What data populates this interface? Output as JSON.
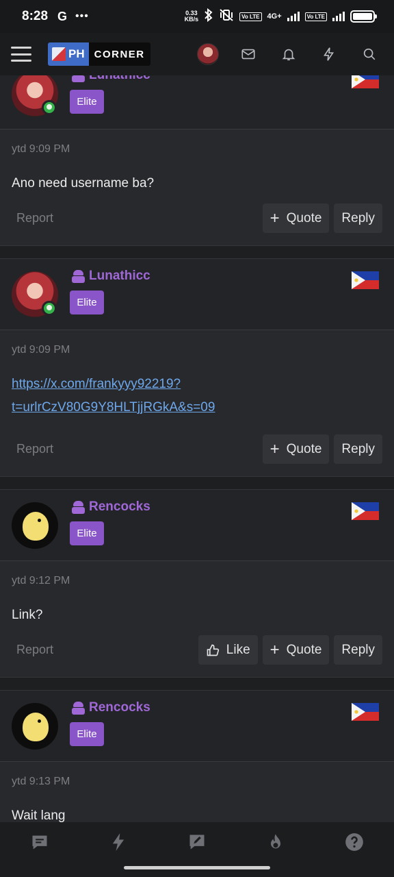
{
  "status_bar": {
    "time": "8:28",
    "carrier_glyph": "G",
    "more": "•••",
    "speed_top": "0.33",
    "speed_bottom": "KB/s",
    "volte_1": "Vo LTE",
    "network": "4G+",
    "volte_2": "Vo LTE"
  },
  "header": {
    "logo_ph": "PH",
    "logo_corner": "CORNER",
    "icons": [
      "menu-icon",
      "avatar",
      "mail-icon",
      "bell-icon",
      "bolt-icon",
      "search-icon"
    ]
  },
  "posts": [
    {
      "username": "Lunathicc",
      "badge": "Elite",
      "avatar": "anime-girl",
      "online": true,
      "timestamp": "ytd 9:09 PM",
      "message": "Ano need username ba?",
      "link": "",
      "report": "Report",
      "buttons": {
        "like": "",
        "quote": "Quote",
        "reply": "Reply"
      }
    },
    {
      "username": "Lunathicc",
      "badge": "Elite",
      "avatar": "anime-girl",
      "online": true,
      "timestamp": "ytd 9:09 PM",
      "message": "",
      "link_line1": "https://x.com/frankyyy92219?",
      "link_line2": "t=urlrCzV80G9Y8HLTjjRGkA&s=09",
      "report": "Report",
      "buttons": {
        "like": "",
        "quote": "Quote",
        "reply": "Reply"
      }
    },
    {
      "username": "Rencocks",
      "badge": "Elite",
      "avatar": "chick",
      "online": false,
      "timestamp": "ytd 9:12 PM",
      "message": "Link?",
      "report": "Report",
      "buttons": {
        "like": "Like",
        "quote": "Quote",
        "reply": "Reply"
      }
    },
    {
      "username": "Rencocks",
      "badge": "Elite",
      "avatar": "chick",
      "online": false,
      "timestamp": "ytd 9:13 PM",
      "message": "Wait lang"
    }
  ],
  "bottom_nav": [
    "chat-icon",
    "bolt-icon",
    "compose-icon",
    "flame-icon",
    "help-icon"
  ],
  "colors": {
    "background": "#1e1f21",
    "username": "#9f68d6",
    "badge": "#8a55c8",
    "link": "#6ea8ec",
    "online": "#36b24a"
  }
}
